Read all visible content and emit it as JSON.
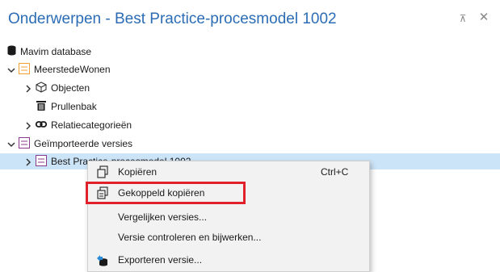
{
  "panel": {
    "title": "Onderwerpen -  Best Practice-procesmodel 1002",
    "pin_glyph": "⊼",
    "close_glyph": "✕"
  },
  "tree": {
    "database": "Mavim database",
    "meerstede": "MeerstedeWonen",
    "objecten": "Objecten",
    "prullenbak": "Prullenbak",
    "relatiecategorieen": "Relatiecategorieën",
    "geimporteerde": "Geïmporteerde versies",
    "best_practice": "Best Practice-procesmodel 1002"
  },
  "context_menu": {
    "items": [
      {
        "label": "Kopiëren",
        "shortcut": "Ctrl+C",
        "icon": "copy-icon"
      },
      {
        "label": "Gekoppeld kopiëren",
        "icon": "linked-copy-icon"
      },
      {
        "label": "Vergelijken versies..."
      },
      {
        "label": "Versie controleren en bijwerken..."
      },
      {
        "label": "Exporteren versie...",
        "icon": "export-icon"
      }
    ]
  },
  "colors": {
    "title_blue": "#2b6cb5",
    "highlight_red": "#e0212b",
    "selection_blue": "#cce4f7",
    "node_orange": "#f0a030",
    "node_purple": "#8a3a8a"
  }
}
